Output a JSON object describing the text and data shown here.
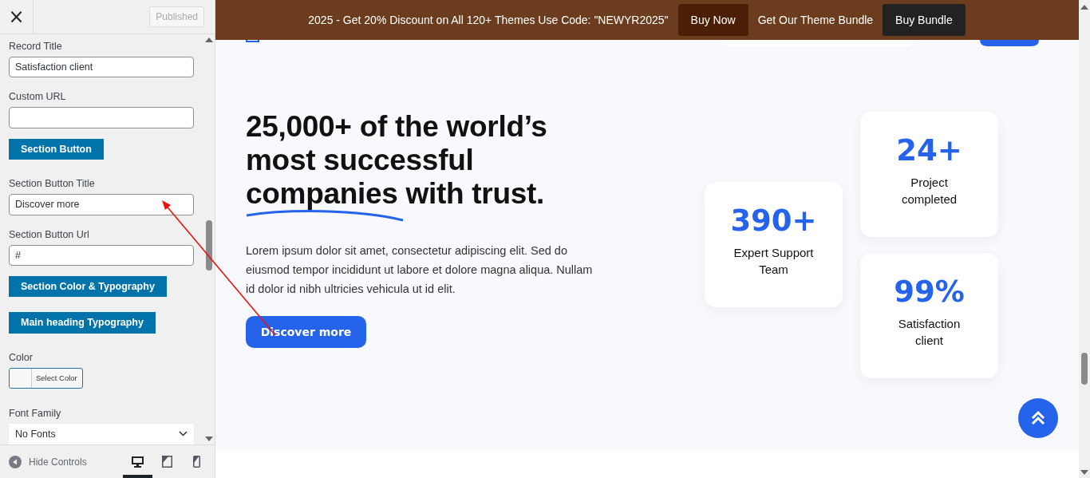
{
  "sidebar": {
    "close": "×",
    "publish_button": {
      "label": "Published",
      "disabled": true
    },
    "controls": [
      {
        "kind": "field",
        "label": "Record Title",
        "value": "Satisfaction client"
      },
      {
        "kind": "field",
        "label": "Custom URL"
      },
      {
        "kind": "section",
        "label": "Section Button"
      },
      {
        "kind": "field",
        "label": "Section Button Title",
        "value": "Discover more"
      },
      {
        "kind": "field",
        "label": "Section Button Url",
        "value": "#"
      },
      {
        "kind": "section",
        "label": "Section Color & Typography"
      },
      {
        "kind": "section",
        "label": "Main heading Typography"
      },
      {
        "kind": "color",
        "label": "Color",
        "button": "Select Color"
      },
      {
        "kind": "select",
        "label": "Font Family",
        "value": "No Fonts"
      }
    ],
    "footer": {
      "hide_controls": "Hide Controls",
      "devices": [
        {
          "kind": "desktop",
          "selected": true
        },
        {
          "kind": "tablet",
          "selected": false
        },
        {
          "kind": "mobile",
          "selected": false
        }
      ]
    }
  },
  "banner": {
    "text": "2025 - Get 20% Discount on All 120+ Themes Use Code: \"NEWYR2025\"",
    "buy_now": "Buy Now",
    "bundle_text": "Get Our Theme Bundle",
    "buy_bundle": "Buy Bundle"
  },
  "hero": {
    "heading_lines": [
      "25,000+ of the world’s",
      "most successful"
    ],
    "heading_underlined": "companies",
    "heading_rest": "with trust.",
    "paragraph": "Lorem ipsum dolor sit amet, consectetur adipiscing elit. Sed do eiusmod tempor incididunt ut labore et dolore magna aliqua. Nullam id dolor id nibh ultricies vehicula ut id elit.",
    "button": "Discover more"
  },
  "stats": [
    {
      "value": "390+",
      "label": "Expert Support Team"
    },
    {
      "value": "24+",
      "label": "Project completed"
    },
    {
      "value": "99%",
      "label": "Satisfaction client"
    }
  ]
}
